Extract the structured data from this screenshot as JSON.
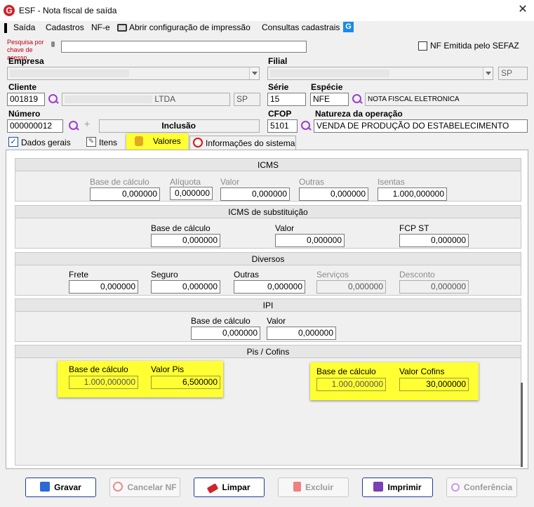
{
  "window": {
    "title": "ESF - Nota fiscal de saída",
    "app_icon": "G",
    "close_glyph": "✕"
  },
  "menu": [
    "Saída",
    "Cadastros",
    "NF-e",
    "Abrir configuração de impressão",
    "Consultas cadastrais"
  ],
  "search": {
    "label": "Pesquisa por chave de acesso",
    "value": ""
  },
  "nf_emitida": {
    "label": "NF Emitida pelo SEFAZ",
    "checked": false
  },
  "empresa": {
    "label": "Empresa",
    "value": "",
    "uf": ""
  },
  "filial": {
    "label": "Filial",
    "value": "",
    "uf": "SP"
  },
  "cliente": {
    "label": "Cliente",
    "code": "001819",
    "name": "LTDA",
    "uf": "SP"
  },
  "serie": {
    "label": "Série",
    "value": "15"
  },
  "especie": {
    "label": "Espécie",
    "code": "NFE",
    "desc": "NOTA FISCAL ELETRONICA"
  },
  "numero": {
    "label": "Número",
    "value": "000000012",
    "mode": "Inclusão"
  },
  "cfop": {
    "label": "CFOP",
    "value": "5101"
  },
  "natureza": {
    "label": "Natureza da operação",
    "value": "VENDA DE PRODUÇÃO DO ESTABELECIMENTO"
  },
  "tabs": [
    {
      "label": "Dados gerais",
      "icon": "checkbox-icon"
    },
    {
      "label": "Itens",
      "icon": "edit-icon"
    },
    {
      "label": "Valores",
      "icon": "coins-icon",
      "active": true
    },
    {
      "label": "Informações do sistema",
      "icon": "no-entry-icon"
    }
  ],
  "icms": {
    "title": "ICMS",
    "base": {
      "label": "Base de cálculo",
      "value": "0,000000"
    },
    "aliquota": {
      "label": "Alíquota",
      "value": "0,000000"
    },
    "valor": {
      "label": "Valor",
      "value": "0,000000"
    },
    "outras": {
      "label": "Outras",
      "value": "0,000000"
    },
    "isentas": {
      "label": "Isentas",
      "value": "1.000,000000"
    }
  },
  "icms_st": {
    "title": "ICMS de substituição",
    "base": {
      "label": "Base de cálculo",
      "value": "0,000000"
    },
    "valor": {
      "label": "Valor",
      "value": "0,000000"
    },
    "fcp": {
      "label": "FCP ST",
      "value": "0,000000"
    }
  },
  "diversos": {
    "title": "Diversos",
    "frete": {
      "label": "Frete",
      "value": "0,000000"
    },
    "seguro": {
      "label": "Seguro",
      "value": "0,000000"
    },
    "outras": {
      "label": "Outras",
      "value": "0,000000"
    },
    "servicos": {
      "label": "Serviços",
      "value": "0,000000"
    },
    "desconto": {
      "label": "Desconto",
      "value": "0,000000"
    }
  },
  "ipi": {
    "title": "IPI",
    "base": {
      "label": "Base de cálculo",
      "value": "0,000000"
    },
    "valor": {
      "label": "Valor",
      "value": "0,000000"
    }
  },
  "pis_cofins": {
    "title": "Pis / Cofins",
    "pis_base": {
      "label": "Base de cálculo",
      "value": "1.000,000000"
    },
    "pis_valor": {
      "label": "Valor Pis",
      "value": "6,500000"
    },
    "cofins_base": {
      "label": "Base de cálculo",
      "value": "1.000,000000"
    },
    "cofins_valor": {
      "label": "Valor Cofins",
      "value": "30,000000"
    }
  },
  "buttons": {
    "gravar": "Gravar",
    "cancelar": "Cancelar NF",
    "limpar": "Limpar",
    "excluir": "Excluir",
    "imprimir": "Imprimir",
    "conferencia": "Conferência"
  },
  "colors": {
    "highlight": "#ffff33",
    "accent": "#1c3d8f",
    "search_icon": "#9b3fc9",
    "brand": "#d0232a"
  }
}
